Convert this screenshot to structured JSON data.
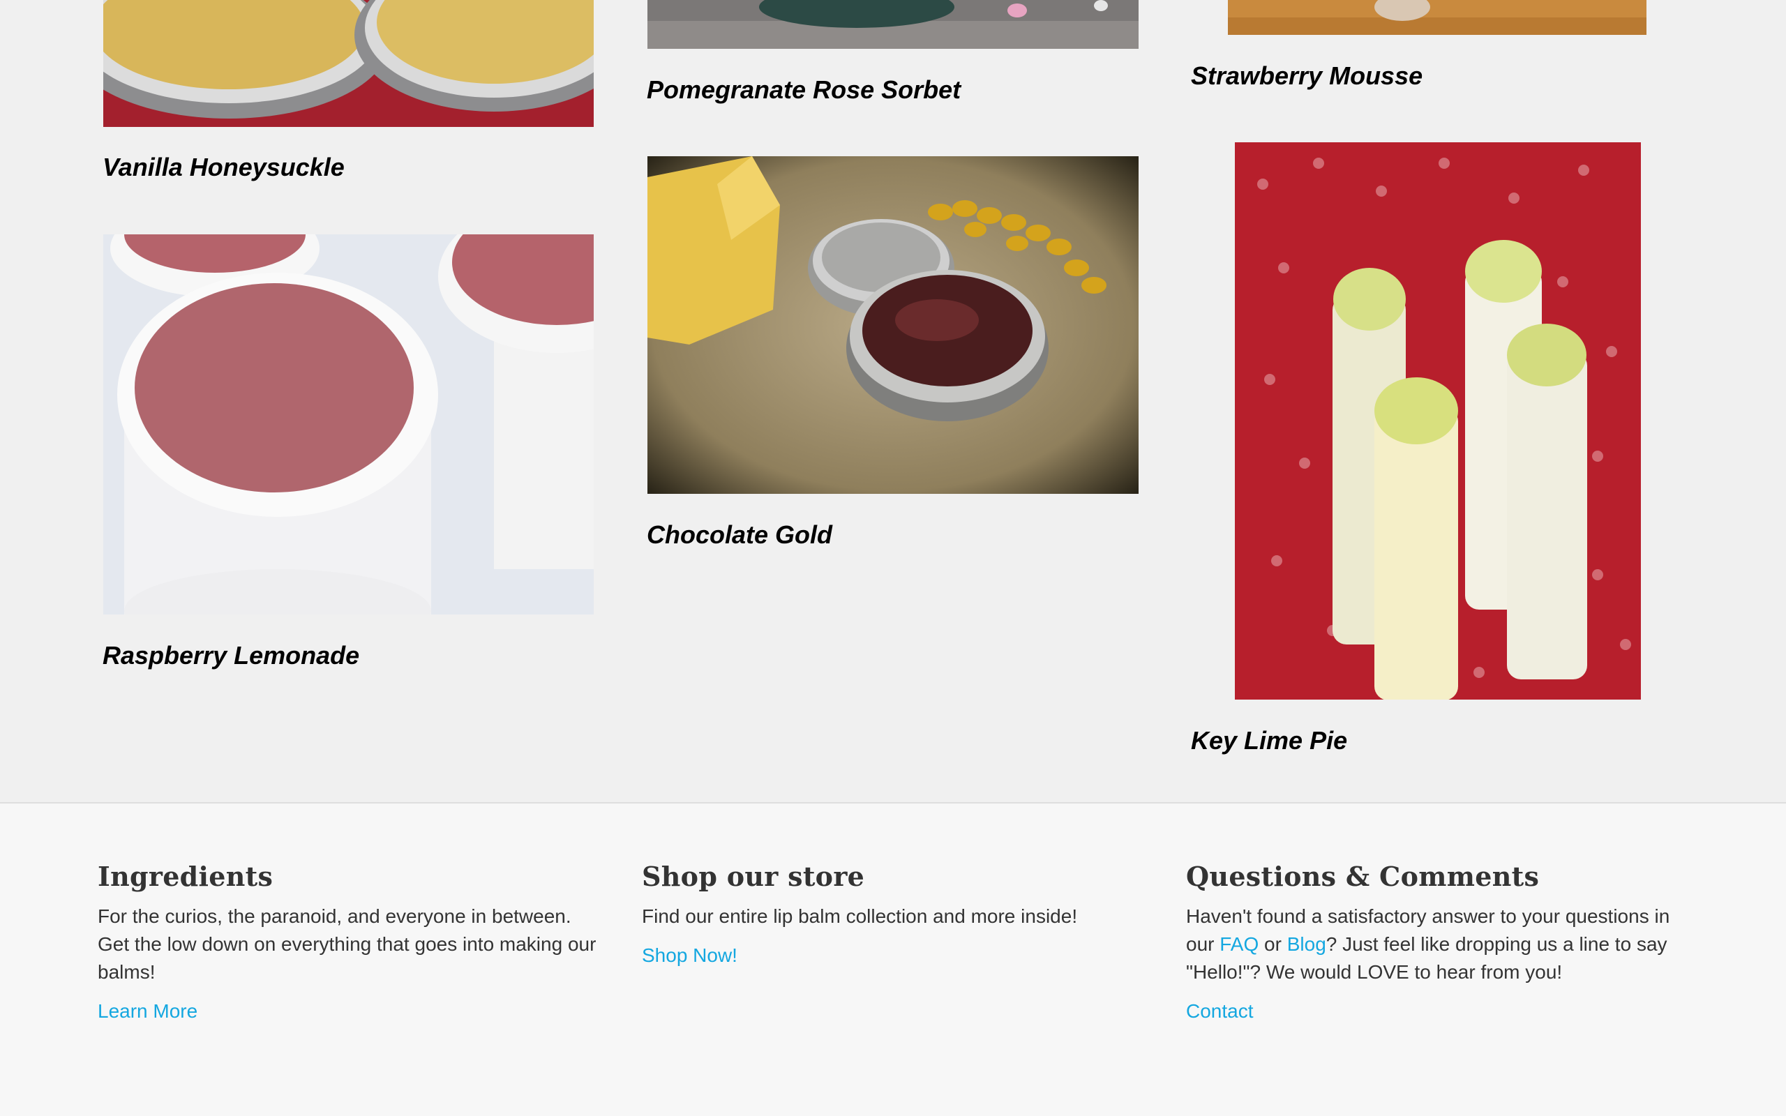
{
  "products": [
    {
      "name": "Vanilla Honeysuckle"
    },
    {
      "name": "Raspberry Lemonade"
    },
    {
      "name": "Pomegranate Rose Sorbet"
    },
    {
      "name": "Chocolate Gold"
    },
    {
      "name": "Strawberry Mousse"
    },
    {
      "name": "Key Lime Pie"
    }
  ],
  "footer": {
    "ingredients": {
      "heading": "Ingredients",
      "text": "For the curios, the paranoid, and everyone in between. Get the low down on everything that goes into making our balms!",
      "link": "Learn More"
    },
    "store": {
      "heading": "Shop our store",
      "text": "Find our entire lip balm collection and more inside!",
      "link": "Shop Now!"
    },
    "questions": {
      "heading": "Questions & Comments",
      "text_before": "Haven't found a satisfactory answer to your questions in our ",
      "faq": "FAQ",
      "or": " or ",
      "blog": "Blog",
      "text_after": "? Just feel like dropping us a line to say \"Hello!\"? We would LOVE to hear from you!",
      "link": "Contact"
    }
  }
}
